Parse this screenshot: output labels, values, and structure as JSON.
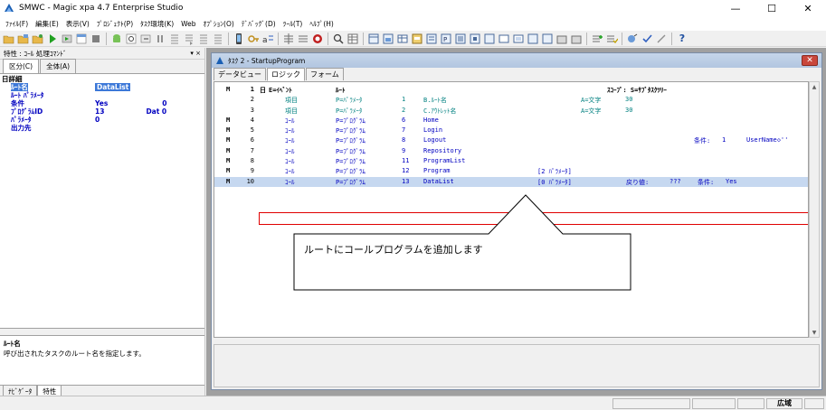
{
  "app": {
    "title": "SMWC - Magic xpa 4.7 Enterprise Studio",
    "minimize": "—",
    "maximize": "☐",
    "close": "✕"
  },
  "menu": [
    "ﾌｧｲﾙ(F)",
    "編集(E)",
    "表示(V)",
    "ﾌﾟﾛｼﾞｪｸﾄ(P)",
    "ﾀｽｸ環境(K)",
    "Web",
    "ｵﾌﾟｼｮﾝ(O)",
    "ﾃﾞﾊﾞｯｸﾞ(D)",
    "ﾂｰﾙ(T)",
    "ﾍﾙﾌﾟ(H)"
  ],
  "toolbar": {
    "help_label": "?"
  },
  "left_panel": {
    "header": "特性 : ｺｰﾙ 処理ｺﾏﾝﾄﾞ",
    "pin": "▾ ×",
    "tabs": [
      "区分(C)",
      "全体(A)"
    ],
    "section": "日詳細",
    "props": [
      {
        "key": "ﾙｰﾄ名",
        "value": "DataList",
        "sub": "",
        "selected": true
      },
      {
        "key": "ﾙｰﾄ ﾊﾟﾗﾒｰﾀ",
        "value": "",
        "sub": ""
      },
      {
        "key": "条件",
        "value": "Yes",
        "sub": "0"
      },
      {
        "key": "ﾌﾟﾛｸﾞﾗﾑID",
        "value": "13",
        "sub": "Dat 0"
      },
      {
        "key": "ﾊﾟﾗﾒｰﾀ",
        "value": "0",
        "sub": ""
      },
      {
        "key": "出力先",
        "value": "",
        "sub": ""
      }
    ],
    "desc_title": "ﾙｰﾄ名",
    "desc_text": "呼び出されたタスクのルート名を指定します。",
    "bottom_tabs": [
      "ﾅﾋﾞｹﾞｰﾀ",
      "特性"
    ]
  },
  "task_window": {
    "title": "ﾀｽｸ 2 -   StartupProgram",
    "close_label": "✕",
    "tabs": [
      "データビュー",
      "ロジック",
      "フォーム"
    ],
    "active_tab": 1,
    "header": {
      "num": "1",
      "tree": "日",
      "kind": "E=ｲﾍﾞﾝﾄ",
      "param": "ﾙｰﾄ",
      "scope": "ｽｺｰﾌﾟ:  S=ｻﾌﾞﾀｽｸﾂﾘｰ",
      "m": "M"
    },
    "rows": [
      {
        "m": "",
        "num": "2",
        "kind": "項目",
        "param": "P=ﾊﾟﾗﾒｰﾀ",
        "idx": "1",
        "name": "B.ﾙｰﾄ名",
        "type": "A=文字",
        "size": "30"
      },
      {
        "m": "",
        "num": "3",
        "kind": "項目",
        "param": "P=ﾊﾟﾗﾒｰﾀ",
        "idx": "2",
        "name": "C.ｱｳﾄﾚｯﾄ名",
        "type": "A=文字",
        "size": "30"
      },
      {
        "m": "M",
        "num": "4",
        "kind": "ｺｰﾙ",
        "param": "P=ﾌﾟﾛｸﾞﾗﾑ",
        "idx": "6",
        "name": "Home"
      },
      {
        "m": "M",
        "num": "5",
        "kind": "ｺｰﾙ",
        "param": "P=ﾌﾟﾛｸﾞﾗﾑ",
        "idx": "7",
        "name": "Login"
      },
      {
        "m": "M",
        "num": "6",
        "kind": "ｺｰﾙ",
        "param": "P=ﾌﾟﾛｸﾞﾗﾑ",
        "idx": "8",
        "name": "Logout",
        "cond": "条件:",
        "condv": "1",
        "uname": "UserName◇''"
      },
      {
        "m": "M",
        "num": "7",
        "kind": "ｺｰﾙ",
        "param": "P=ﾌﾟﾛｸﾞﾗﾑ",
        "idx": "9",
        "name": "Repository"
      },
      {
        "m": "M",
        "num": "8",
        "kind": "ｺｰﾙ",
        "param": "P=ﾌﾟﾛｸﾞﾗﾑ",
        "idx": "11",
        "name": "ProgramList"
      },
      {
        "m": "M",
        "num": "9",
        "kind": "ｺｰﾙ",
        "param": "P=ﾌﾟﾛｸﾞﾗﾑ",
        "idx": "12",
        "name": "Program",
        "arg": "[2 ﾊﾟﾗﾒｰﾀ]"
      },
      {
        "m": "M",
        "num": "10",
        "kind": "ｺｰﾙ",
        "param": "P=ﾌﾟﾛｸﾞﾗﾑ",
        "idx": "13",
        "name": "DataList",
        "arg": "[0 ﾊﾟﾗﾒｰﾀ]",
        "ret": "戻り値:",
        "retv": "???",
        "cond": "条件:",
        "condv": "Yes",
        "highlight": true
      }
    ]
  },
  "callout": {
    "text": "ルートにコールプログラムを追加します"
  },
  "statusbar": {
    "mode": "広域"
  },
  "colors": {
    "accent_red": "#e00000",
    "selection_blue": "#3c78d8",
    "teal_text": "#008080",
    "blue_text": "#0000c0"
  }
}
